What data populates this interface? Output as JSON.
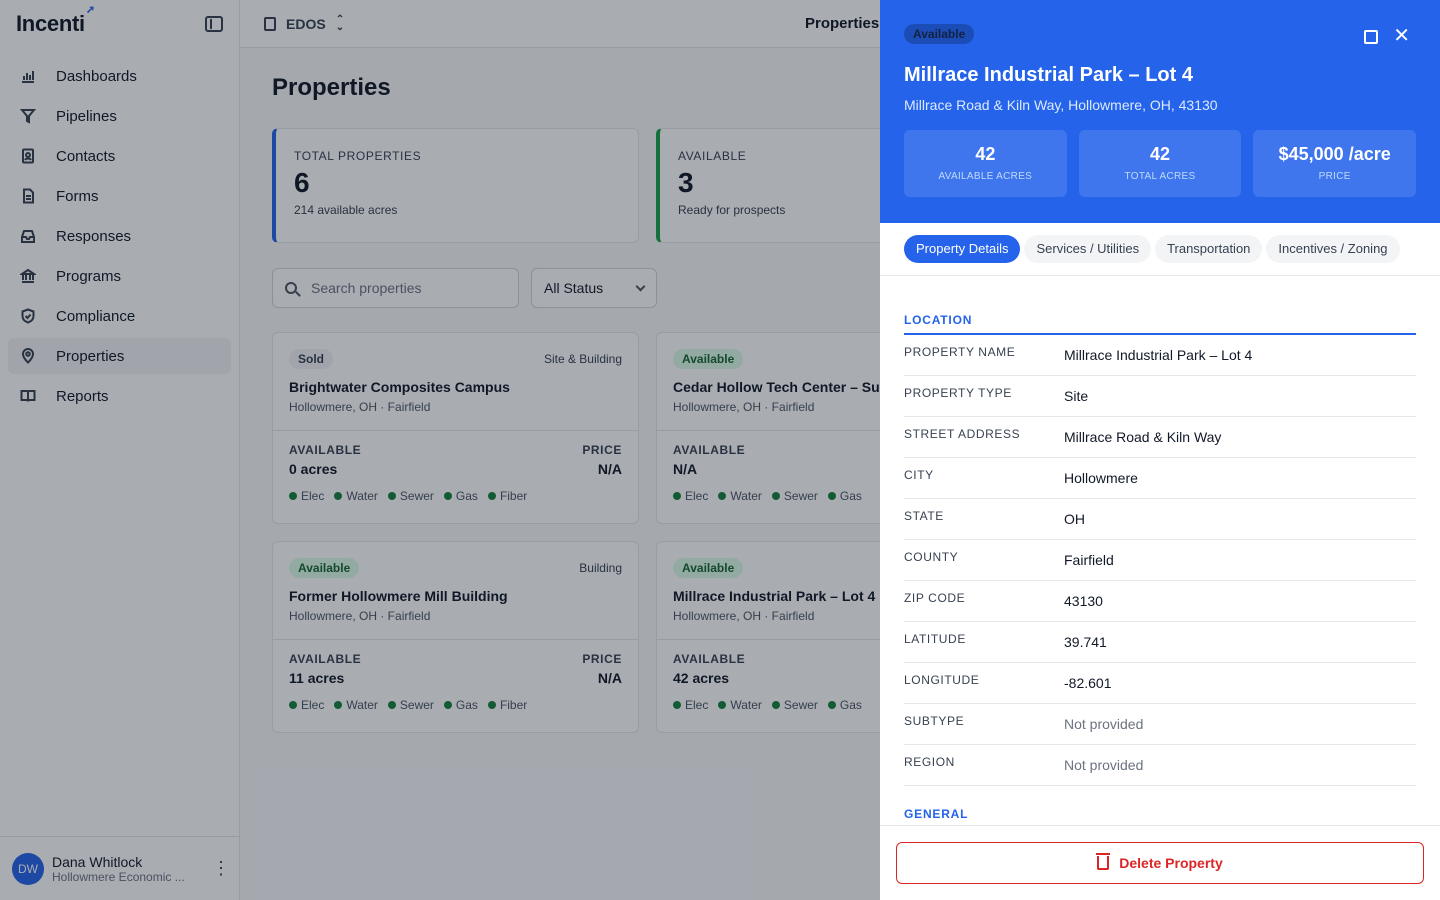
{
  "brand": {
    "name": "Incenti"
  },
  "sidebar": {
    "items": [
      {
        "label": "Dashboards",
        "icon": "chart-icon"
      },
      {
        "label": "Pipelines",
        "icon": "funnel-icon"
      },
      {
        "label": "Contacts",
        "icon": "contact-card-icon"
      },
      {
        "label": "Forms",
        "icon": "document-icon"
      },
      {
        "label": "Responses",
        "icon": "inbox-icon"
      },
      {
        "label": "Programs",
        "icon": "bank-icon"
      },
      {
        "label": "Compliance",
        "icon": "shield-icon"
      },
      {
        "label": "Properties",
        "icon": "map-pin-icon",
        "active": true
      },
      {
        "label": "Reports",
        "icon": "book-icon"
      }
    ]
  },
  "user": {
    "initials": "DW",
    "name": "Dana Whitlock",
    "org": "Hollowmere Economic ..."
  },
  "topbar": {
    "org": "EDOS",
    "title": "Properties"
  },
  "page": {
    "title": "Properties",
    "stats": [
      {
        "label": "TOTAL PROPERTIES",
        "value": "6",
        "sub": "214 available acres"
      },
      {
        "label": "AVAILABLE",
        "value": "3",
        "sub": "Ready for prospects"
      }
    ],
    "search": {
      "placeholder": "Search properties"
    },
    "status_filter": "All Status",
    "cards": [
      {
        "status": "Sold",
        "type": "Site & Building",
        "name": "Brightwater Composites Campus",
        "location": "Hollowmere, OH · Fairfield",
        "available_label": "AVAILABLE",
        "available": "0 acres",
        "price_label": "PRICE",
        "price": "N/A",
        "utilities": [
          "Elec",
          "Water",
          "Sewer",
          "Gas",
          "Fiber"
        ]
      },
      {
        "status": "Available",
        "type": "",
        "name": "Cedar Hollow Tech Center – Su",
        "location": "Hollowmere, OH · Fairfield",
        "available_label": "AVAILABLE",
        "available": "N/A",
        "price_label": "",
        "price": "",
        "utilities": [
          "Elec",
          "Water",
          "Sewer",
          "Gas"
        ]
      },
      {
        "status": "Available",
        "type": "Building",
        "name": "Former Hollowmere Mill Building",
        "location": "Hollowmere, OH · Fairfield",
        "available_label": "AVAILABLE",
        "available": "11 acres",
        "price_label": "PRICE",
        "price": "N/A",
        "utilities": [
          "Elec",
          "Water",
          "Sewer",
          "Gas",
          "Fiber"
        ]
      },
      {
        "status": "Available",
        "type": "",
        "name": "Millrace Industrial Park – Lot 4",
        "location": "Hollowmere, OH · Fairfield",
        "available_label": "AVAILABLE",
        "available": "42 acres",
        "price_label": "",
        "price": "",
        "utilities": [
          "Elec",
          "Water",
          "Sewer",
          "Gas"
        ]
      }
    ]
  },
  "panel": {
    "status": "Available",
    "title": "Millrace Industrial Park – Lot 4",
    "address": "Millrace Road & Kiln Way, Hollowmere, OH, 43130",
    "stats": [
      {
        "value": "42",
        "label": "AVAILABLE ACRES"
      },
      {
        "value": "42",
        "label": "TOTAL ACRES"
      },
      {
        "value": "$45,000 /acre",
        "label": "PRICE"
      }
    ],
    "tabs": [
      "Property Details",
      "Services / Utilities",
      "Transportation",
      "Incentives / Zoning"
    ],
    "section_location": "LOCATION",
    "rows": [
      {
        "label": "PROPERTY NAME",
        "value": "Millrace Industrial Park – Lot 4"
      },
      {
        "label": "PROPERTY TYPE",
        "value": "Site"
      },
      {
        "label": "STREET ADDRESS",
        "value": "Millrace Road & Kiln Way"
      },
      {
        "label": "CITY",
        "value": "Hollowmere"
      },
      {
        "label": "STATE",
        "value": "OH"
      },
      {
        "label": "COUNTY",
        "value": "Fairfield"
      },
      {
        "label": "ZIP CODE",
        "value": "43130"
      },
      {
        "label": "LATITUDE",
        "value": "39.741"
      },
      {
        "label": "LONGITUDE",
        "value": "-82.601"
      },
      {
        "label": "SUBTYPE",
        "value": "Not provided"
      },
      {
        "label": "REGION",
        "value": "Not provided"
      }
    ],
    "section_general": "GENERAL",
    "delete_label": "Delete Property"
  },
  "colors": {
    "accent": "#2563eb",
    "danger": "#dc2626",
    "success": "#15803d"
  }
}
